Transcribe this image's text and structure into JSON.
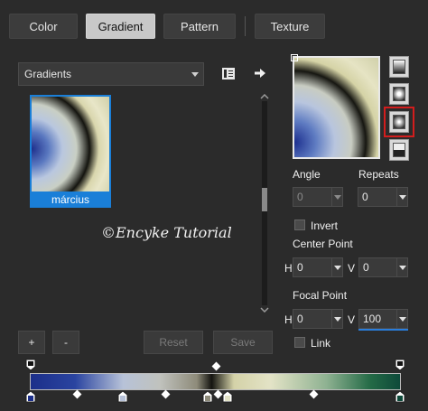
{
  "tabs": [
    {
      "label": "Color",
      "active": false
    },
    {
      "label": "Gradient",
      "active": true
    },
    {
      "label": "Pattern",
      "active": false
    },
    {
      "label": "Texture",
      "active": false
    }
  ],
  "library": {
    "dropdown_value": "Gradients",
    "item_name": "március"
  },
  "watermark": "©Encyke Tutorial",
  "angle": {
    "label": "Angle",
    "value": "0"
  },
  "repeats": {
    "label": "Repeats",
    "value": "0"
  },
  "invert": {
    "label": "Invert",
    "checked": false
  },
  "center_point": {
    "label": "Center Point",
    "h_label": "H",
    "h_value": "0",
    "v_label": "V",
    "v_value": "0"
  },
  "focal_point": {
    "label": "Focal Point",
    "h_label": "H",
    "h_value": "0",
    "v_label": "V",
    "v_value": "100"
  },
  "link": {
    "label": "Link",
    "checked": false
  },
  "buttons": {
    "add": "+",
    "remove": "-",
    "reset": "Reset",
    "save": "Save"
  },
  "colors": {
    "accent": "#1a7fd8",
    "selection_outline": "#d21d1d"
  }
}
